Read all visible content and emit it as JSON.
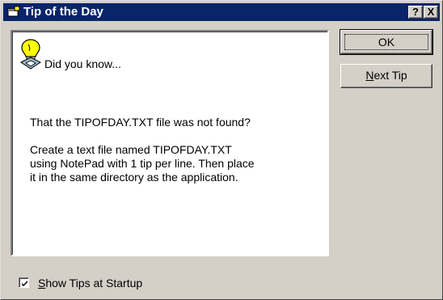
{
  "window": {
    "title": "Tip of the Day",
    "help_glyph": "?",
    "close_glyph": "X",
    "icons": {
      "title": "window-icon",
      "tip": "lightbulb-icon",
      "checkbox": "checkmark-icon"
    }
  },
  "tip": {
    "heading": "Did you know...",
    "body": "That the TIPOFDAY.TXT file was not found?\n\nCreate a text file named TIPOFDAY.TXT\nusing NotePad with 1 tip per line. Then place\nit in the same directory as the application."
  },
  "buttons": {
    "ok_label": "OK",
    "next_tip_mnemonic": "N",
    "next_tip_rest": "ext Tip"
  },
  "startup": {
    "checked": true,
    "label_mnemonic": "S",
    "label_rest": "how Tips at Startup"
  }
}
